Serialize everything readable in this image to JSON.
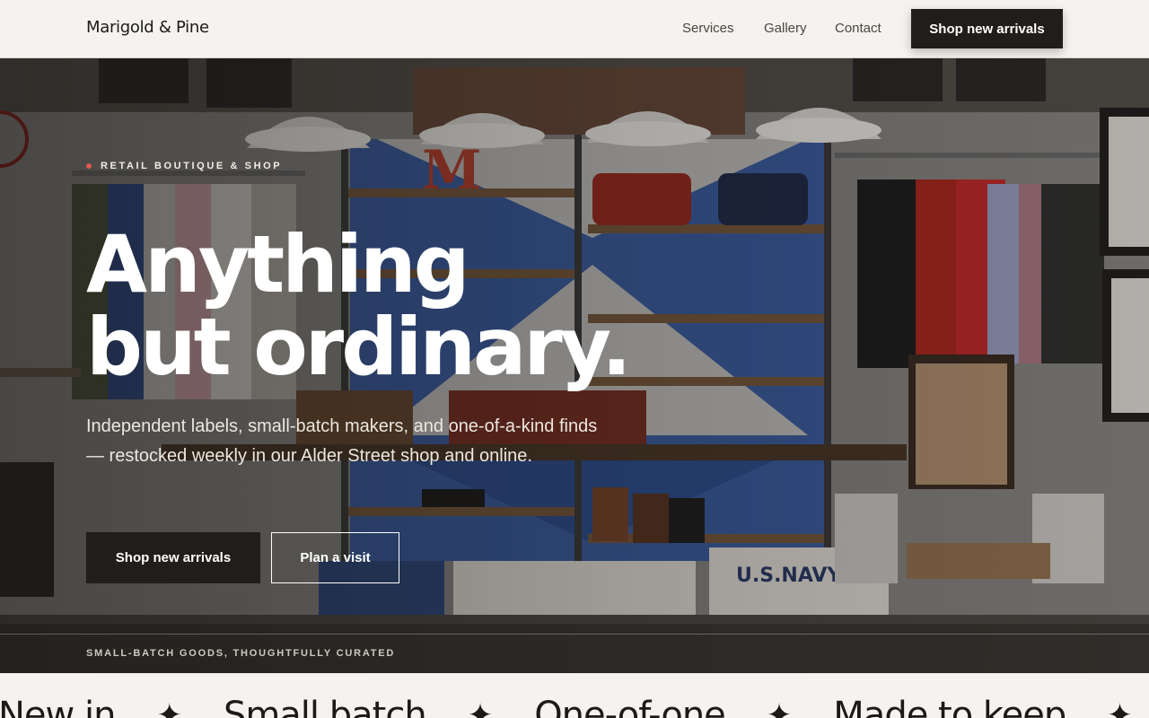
{
  "header": {
    "logo": "Marigold & Pine",
    "nav": [
      {
        "label": "Services"
      },
      {
        "label": "Gallery"
      },
      {
        "label": "Contact"
      }
    ],
    "cta_label": "Shop new arrivals"
  },
  "hero": {
    "eyebrow": "RETAIL BOUTIQUE & SHOP",
    "headline_line1": "Anything",
    "headline_line2": "but ordinary.",
    "subtext": "Independent labels, small-batch makers, and one-of-a-kind finds — restocked weekly in our Alder Street shop and online.",
    "primary_button": "Shop new arrivals",
    "secondary_button": "Plan a visit",
    "footer_tagline": "SMALL-BATCH GOODS, THOUGHTFULLY CURATED",
    "accent_dot_color": "#e0564e"
  },
  "marquee": {
    "items": [
      "New in",
      "Small batch",
      "One-of-one",
      "Made to keep"
    ],
    "separator_icon": "four-point-star-icon"
  }
}
